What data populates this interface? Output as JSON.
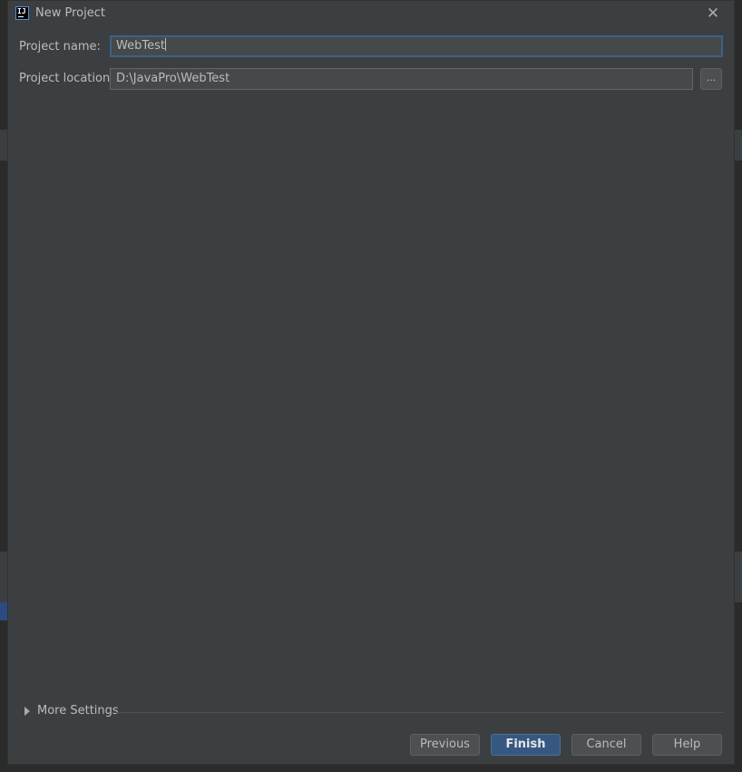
{
  "window": {
    "title": "New Project",
    "icon": "intellij-idea-icon"
  },
  "form": {
    "project_name_label": "Project name:",
    "project_name_value": "WebTest",
    "project_location_label": "Project location:",
    "project_location_value": "D:\\JavaPro\\WebTest",
    "browse_label": "..."
  },
  "more_settings": {
    "label": "More Settings",
    "expanded": false
  },
  "buttons": {
    "previous": "Previous",
    "finish": "Finish",
    "cancel": "Cancel",
    "help": "Help"
  },
  "colors": {
    "dialog_bg": "#3c3f41",
    "input_bg": "#45494a",
    "focus_border": "#3d6185",
    "default_button_bg": "#365880"
  }
}
